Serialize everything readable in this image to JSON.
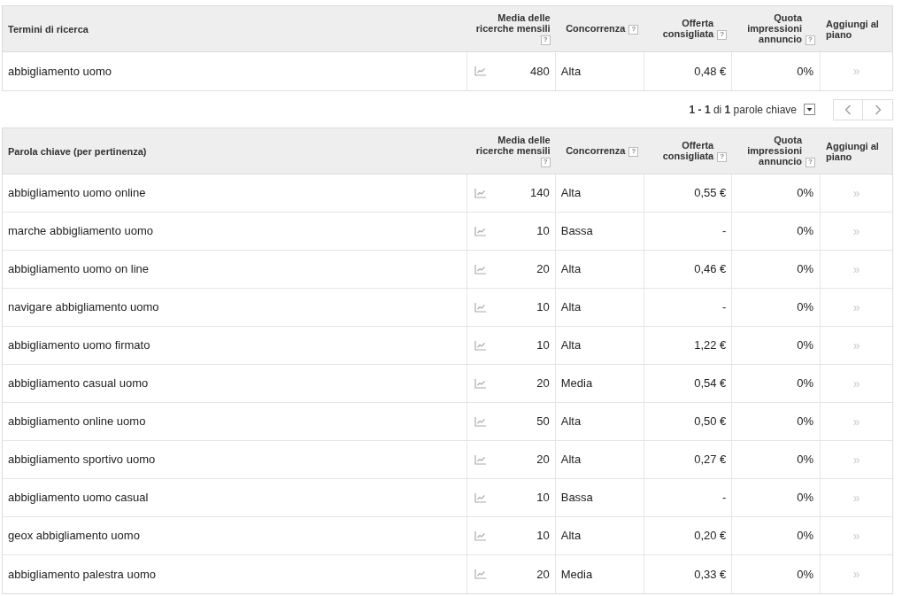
{
  "search_terms_table": {
    "columns": [
      {
        "label": "Termini di ricerca"
      },
      {
        "label": "Media delle ricerche mensili",
        "help": "?"
      },
      {
        "label": "Concorrenza",
        "help": "?"
      },
      {
        "label": "Offerta consigliata",
        "help": "?"
      },
      {
        "label": "Quota impressioni annuncio",
        "help": "?"
      },
      {
        "label": "Aggiungi al piano"
      }
    ],
    "rows": [
      {
        "keyword": "abbigliamento uomo",
        "searches": "480",
        "competition": "Alta",
        "bid": "0,48 €",
        "share": "0%",
        "add": "»"
      }
    ]
  },
  "pager": {
    "text": "**1 - 1** di **1** parole chiave"
  },
  "keywords_table": {
    "columns": [
      {
        "label": "Parola chiave (per pertinenza)"
      },
      {
        "label": "Media delle ricerche mensili",
        "help": "?"
      },
      {
        "label": "Concorrenza",
        "help": "?"
      },
      {
        "label": "Offerta consigliata",
        "help": "?"
      },
      {
        "label": "Quota impressioni annuncio",
        "help": "?"
      },
      {
        "label": "Aggiungi al piano"
      }
    ],
    "rows": [
      {
        "keyword": "abbigliamento uomo online",
        "searches": "140",
        "competition": "Alta",
        "bid": "0,55 €",
        "share": "0%",
        "add": "»"
      },
      {
        "keyword": "marche abbigliamento uomo",
        "searches": "10",
        "competition": "Bassa",
        "bid": "-",
        "share": "0%",
        "add": "»"
      },
      {
        "keyword": "abbigliamento uomo on line",
        "searches": "20",
        "competition": "Alta",
        "bid": "0,46 €",
        "share": "0%",
        "add": "»"
      },
      {
        "keyword": "navigare abbigliamento uomo",
        "searches": "10",
        "competition": "Alta",
        "bid": "-",
        "share": "0%",
        "add": "»"
      },
      {
        "keyword": "abbigliamento uomo firmato",
        "searches": "10",
        "competition": "Alta",
        "bid": "1,22 €",
        "share": "0%",
        "add": "»"
      },
      {
        "keyword": "abbigliamento casual uomo",
        "searches": "20",
        "competition": "Media",
        "bid": "0,54 €",
        "share": "0%",
        "add": "»"
      },
      {
        "keyword": "abbigliamento online uomo",
        "searches": "50",
        "competition": "Alta",
        "bid": "0,50 €",
        "share": "0%",
        "add": "»"
      },
      {
        "keyword": "abbigliamento sportivo uomo",
        "searches": "20",
        "competition": "Alta",
        "bid": "0,27 €",
        "share": "0%",
        "add": "»"
      },
      {
        "keyword": "abbigliamento uomo casual",
        "searches": "10",
        "competition": "Bassa",
        "bid": "-",
        "share": "0%",
        "add": "»"
      },
      {
        "keyword": "geox abbigliamento uomo",
        "searches": "10",
        "competition": "Alta",
        "bid": "0,20 €",
        "share": "0%",
        "add": "»"
      },
      {
        "keyword": "abbigliamento palestra uomo",
        "searches": "20",
        "competition": "Media",
        "bid": "0,33 €",
        "share": "0%",
        "add": "»"
      }
    ]
  }
}
